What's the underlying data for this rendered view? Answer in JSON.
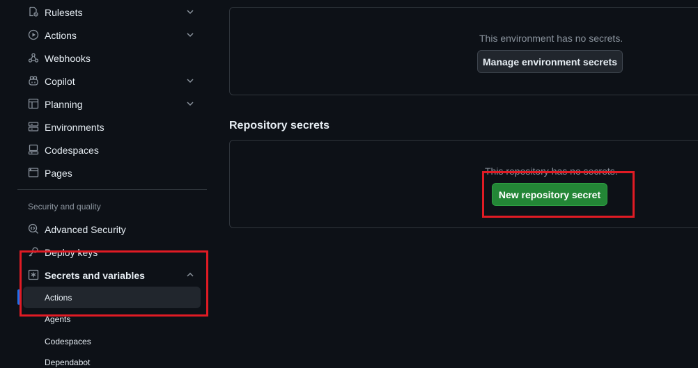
{
  "sidebar": {
    "items": [
      {
        "label": "Rulesets",
        "icon": "ruleset-icon"
      },
      {
        "label": "Actions",
        "icon": "play-icon"
      },
      {
        "label": "Webhooks",
        "icon": "webhook-icon"
      },
      {
        "label": "Copilot",
        "icon": "copilot-icon"
      },
      {
        "label": "Planning",
        "icon": "table-icon"
      },
      {
        "label": "Environments",
        "icon": "server-icon"
      },
      {
        "label": "Codespaces",
        "icon": "codespaces-icon"
      },
      {
        "label": "Pages",
        "icon": "browser-icon"
      }
    ],
    "security_heading": "Security and quality",
    "security_items": [
      {
        "label": "Advanced Security",
        "icon": "codescan-icon"
      },
      {
        "label": "Deploy keys",
        "icon": "key-icon"
      },
      {
        "label": "Secrets and variables",
        "icon": "key-asterisk-icon"
      }
    ],
    "sub_items": [
      {
        "label": "Actions",
        "active": true
      },
      {
        "label": "Agents",
        "active": false
      },
      {
        "label": "Codespaces",
        "active": false
      },
      {
        "label": "Dependabot",
        "active": false
      }
    ]
  },
  "environment_secrets": {
    "empty_message": "This environment has no secrets.",
    "manage_button": "Manage environment secrets"
  },
  "repository_secrets": {
    "title": "Repository secrets",
    "empty_message": "This repository has no secrets.",
    "new_button": "New repository secret"
  },
  "colors": {
    "background": "#0d1117",
    "border": "#30363d",
    "primary_button": "#238636",
    "active_indicator": "#1f6feb",
    "highlight": "#e01b24"
  }
}
